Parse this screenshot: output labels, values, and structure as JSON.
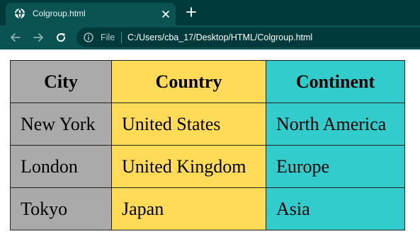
{
  "browser": {
    "tab_title": "Colgroup.html",
    "file_label": "File",
    "url": "C:/Users/cba_17/Desktop/HTML/Colgroup.html"
  },
  "colors": {
    "tab_strip": "#003a3a",
    "toolbar": "#0b5353",
    "col_city": "#aaaaaa",
    "col_country": "#ffdb58",
    "col_continent": "#33cccc"
  },
  "table": {
    "headers": [
      "City",
      "Country",
      "Continent"
    ],
    "rows": [
      [
        "New York",
        "United States",
        "North America"
      ],
      [
        "London",
        "United Kingdom",
        "Europe"
      ],
      [
        "Tokyo",
        "Japan",
        "Asia"
      ]
    ]
  }
}
